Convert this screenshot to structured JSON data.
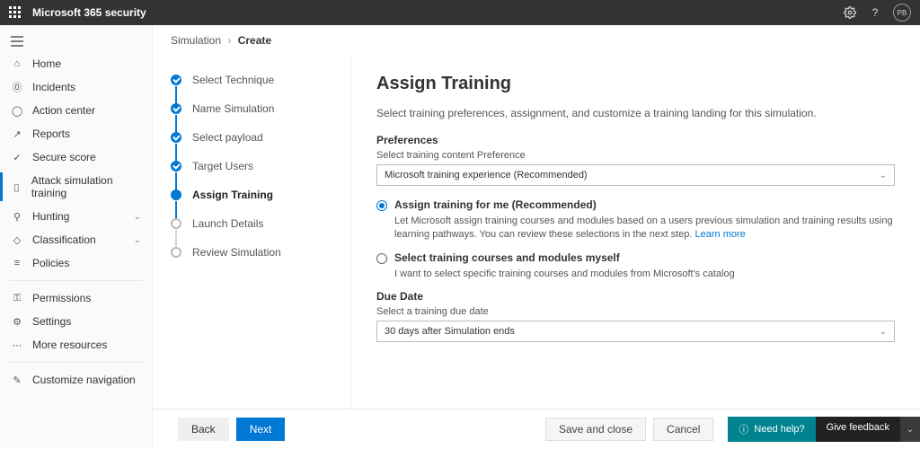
{
  "header": {
    "product": "Microsoft 365 security",
    "avatar_initials": "PB"
  },
  "nav": {
    "items": [
      {
        "label": "Home"
      },
      {
        "label": "Incidents"
      },
      {
        "label": "Action center"
      },
      {
        "label": "Reports"
      },
      {
        "label": "Secure score"
      },
      {
        "label": "Attack simulation training"
      },
      {
        "label": "Hunting"
      },
      {
        "label": "Classification"
      },
      {
        "label": "Policies"
      }
    ],
    "secondary": [
      {
        "label": "Permissions"
      },
      {
        "label": "Settings"
      },
      {
        "label": "More resources"
      }
    ],
    "tertiary": [
      {
        "label": "Customize navigation"
      }
    ]
  },
  "breadcrumb": {
    "root": "Simulation",
    "current": "Create"
  },
  "steps": [
    {
      "label": "Select Technique"
    },
    {
      "label": "Name Simulation"
    },
    {
      "label": "Select payload"
    },
    {
      "label": "Target Users"
    },
    {
      "label": "Assign Training"
    },
    {
      "label": "Launch Details"
    },
    {
      "label": "Review Simulation"
    }
  ],
  "page": {
    "title": "Assign Training",
    "subtitle": "Select training preferences, assignment, and customize a training landing for this simulation.",
    "preferences_label": "Preferences",
    "pref_field_label": "Select training content Preference",
    "pref_value": "Microsoft training experience (Recommended)",
    "radio1_label": "Assign training for me (Recommended)",
    "radio1_desc": "Let Microsoft assign training courses and modules based on a users previous simulation and training results using learning pathways. You can review these selections in the next step. ",
    "radio1_link": "Learn more",
    "radio2_label": "Select training courses and modules myself",
    "radio2_desc": "I want to select specific training courses and modules from Microsoft's catalog",
    "due_label": "Due Date",
    "due_field_label": "Select a training due date",
    "due_value": "30 days after Simulation ends"
  },
  "footer": {
    "back": "Back",
    "next": "Next",
    "save": "Save and close",
    "cancel": "Cancel",
    "help": "Need help?",
    "feedback": "Give feedback"
  }
}
